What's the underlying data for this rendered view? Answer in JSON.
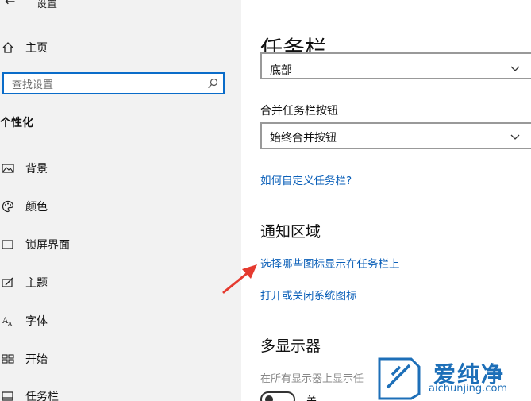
{
  "window": {
    "app_title": "设置"
  },
  "sidebar": {
    "home_label": "主页",
    "search_placeholder": "查找设置",
    "section_heading": "个性化",
    "items": [
      {
        "label": "背景",
        "icon": "picture-icon"
      },
      {
        "label": "颜色",
        "icon": "palette-icon"
      },
      {
        "label": "锁屏界面",
        "icon": "lock-screen-icon"
      },
      {
        "label": "主题",
        "icon": "theme-icon"
      },
      {
        "label": "字体",
        "icon": "font-icon"
      },
      {
        "label": "开始",
        "icon": "start-icon"
      },
      {
        "label": "任务栏",
        "icon": "taskbar-icon"
      }
    ]
  },
  "main": {
    "page_title": "任务栏",
    "position_dropdown_value": "底部",
    "combine_label": "合并任务栏按钮",
    "combine_value": "始终合并按钮",
    "customize_link": "如何自定义任务栏?",
    "notification_heading": "通知区域",
    "select_icons_link": "选择哪些图标显示在任务栏上",
    "system_icons_link": "打开或关闭系统图标",
    "multi_display_heading": "多显示器",
    "multi_display_subtext": "在所有显示器上显示任",
    "toggle_label": "关"
  },
  "watermark": {
    "brand": "爱纯净",
    "url": "aichunjing.com"
  },
  "colors": {
    "accent": "#0a6cc9",
    "link": "#0a5fb8",
    "arrow": "#e53a2f",
    "watermark": "#1d6fb8"
  }
}
